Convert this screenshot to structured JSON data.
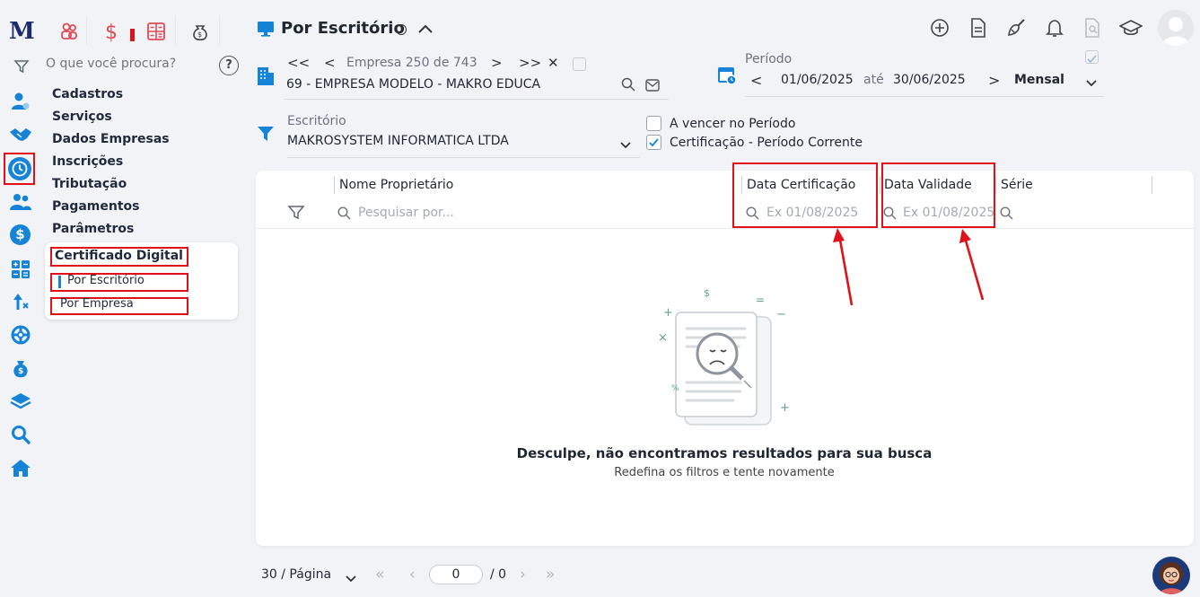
{
  "app": {
    "logo_text": "M"
  },
  "search": {
    "placeholder": "O que você procura?",
    "help": "?"
  },
  "menu": {
    "items": [
      "Cadastros",
      "Serviços",
      "Dados Empresas",
      "Inscrições",
      "Tributação",
      "Pagamentos",
      "Parâmetros"
    ],
    "submenu_title": "Certificado Digital",
    "submenu_items": [
      "Por Escritório",
      "Por Empresa"
    ]
  },
  "header": {
    "title": "Por Escritório",
    "company_nav": {
      "first": "<<",
      "prev": "<",
      "label": "Empresa 250 de 743",
      "next": ">",
      "last": ">>",
      "close": "✕"
    },
    "company_value": "69 - EMPRESA MODELO - MAKRO EDUCA",
    "period": {
      "label": "Período",
      "prev": "<",
      "start": "01/06/2025",
      "until": "até",
      "end": "30/06/2025",
      "next": ">",
      "type": "Mensal"
    },
    "office": {
      "label": "Escritório",
      "value": "MAKROSYSTEM INFORMATICA LTDA"
    },
    "checks": [
      {
        "label": "A vencer no Período",
        "checked": false
      },
      {
        "label": "Certificação - Período Corrente",
        "checked": true
      }
    ]
  },
  "table": {
    "columns": [
      "Nome Proprietário",
      "Data Certificação",
      "Data Validade",
      "Série"
    ],
    "filters": {
      "name_placeholder": "Pesquisar por...",
      "cert_placeholder": "Ex 01/08/2025",
      "valid_placeholder": "Ex 01/08/2025"
    }
  },
  "empty": {
    "title": "Desculpe, não encontramos resultados para sua busca",
    "subtitle": "Redefina os filtros e tente novamente",
    "marks": {
      "dollar": "$",
      "equals": "=",
      "minus": "−",
      "plus": "+",
      "times": "×",
      "percent": "%"
    }
  },
  "pagination": {
    "per_page": "30 / Página",
    "first": "«",
    "prev": "‹",
    "current": "0",
    "total": "/ 0",
    "next": "›",
    "last": "»"
  },
  "colors": {
    "accent": "#1583d8",
    "brand": "#1b2b6b",
    "highlight": "#e1111a",
    "background": "#f1f3f6"
  }
}
